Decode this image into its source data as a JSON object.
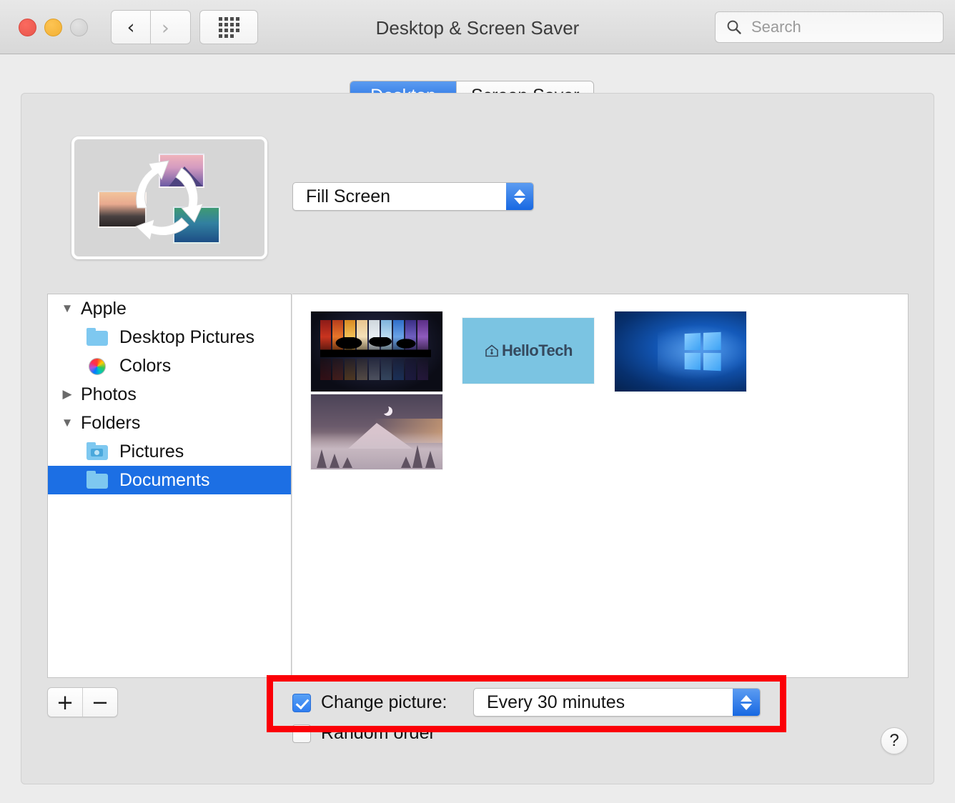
{
  "window": {
    "title": "Desktop & Screen Saver"
  },
  "titlebar": {
    "back_icon": "chevron-left-icon",
    "forward_icon": "chevron-right-icon",
    "grid_icon": "grid-dots-icon",
    "traffic": {
      "close": "close-button",
      "minimize": "minimize-button",
      "zoom": "zoom-button"
    }
  },
  "search": {
    "placeholder": "Search",
    "icon": "search-icon"
  },
  "tabs": [
    {
      "label": "Desktop",
      "selected": true
    },
    {
      "label": "Screen Saver",
      "selected": false
    }
  ],
  "preview": {
    "name": "desktop-preview",
    "icon": "rotating-wallpapers-icon"
  },
  "fill_popup": {
    "value": "Fill Screen",
    "stepper_icon": "stepper-up-down-icon"
  },
  "tree": {
    "rows": [
      {
        "label": "Apple",
        "disclosure": "▼",
        "type": "group",
        "level": 0,
        "icon": "none",
        "selected": false
      },
      {
        "label": "Desktop Pictures",
        "disclosure": "",
        "type": "child",
        "level": 1,
        "icon": "folder-icon",
        "selected": false
      },
      {
        "label": "Colors",
        "disclosure": "",
        "type": "child",
        "level": 1,
        "icon": "color-wheel-icon",
        "selected": false
      },
      {
        "label": "Photos",
        "disclosure": "▶",
        "type": "group",
        "level": 0,
        "icon": "none",
        "selected": false
      },
      {
        "label": "Folders",
        "disclosure": "▼",
        "type": "group",
        "level": 0,
        "icon": "none",
        "selected": false
      },
      {
        "label": "Pictures",
        "disclosure": "",
        "type": "child",
        "level": 1,
        "icon": "camera-folder-icon",
        "selected": false
      },
      {
        "label": "Documents",
        "disclosure": "",
        "type": "child",
        "level": 1,
        "icon": "folder-icon",
        "selected": true
      }
    ]
  },
  "thumbnails": [
    {
      "name": "sunset-trees-wallpaper",
      "kind": "sunset-strips"
    },
    {
      "name": "hellotech-wallpaper",
      "kind": "hellotech",
      "text": "HelloTech",
      "icon": "house-icon",
      "bg": "#7bc4e2"
    },
    {
      "name": "windows-logo-wallpaper",
      "kind": "windows"
    },
    {
      "name": "moonlit-mountain-wallpaper",
      "kind": "moon-mountain"
    }
  ],
  "sidebar_buttons": {
    "add_label": "+",
    "remove_label": "−"
  },
  "options": {
    "change_picture": {
      "label": "Change picture:",
      "checked": true
    },
    "random_order": {
      "label": "Random order",
      "checked": false
    },
    "interval": {
      "value": "Every 30 minutes",
      "stepper_icon": "stepper-up-down-icon"
    }
  },
  "highlight": {
    "color": "#fb0007",
    "name": "annotation-highlight-box"
  },
  "help": {
    "label": "?"
  }
}
